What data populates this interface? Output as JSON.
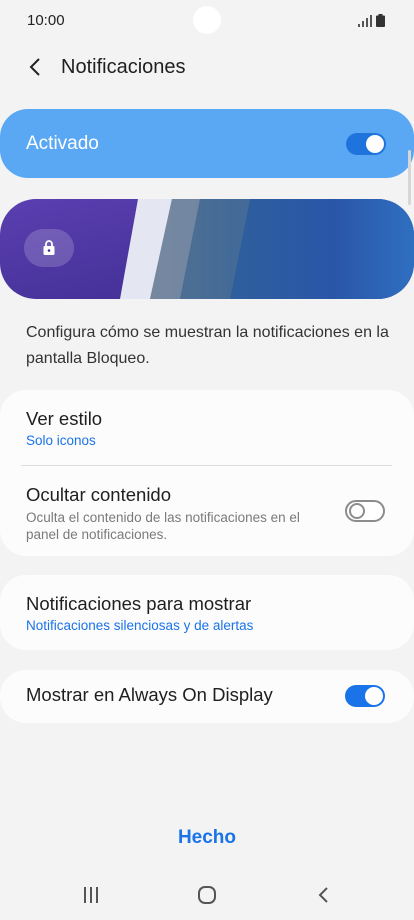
{
  "status_bar": {
    "time": "10:00"
  },
  "header": {
    "title": "Notificaciones"
  },
  "master_toggle": {
    "label": "Activado",
    "on": true
  },
  "description": "Configura cómo se muestran la notificaciones en la pantalla Bloqueo.",
  "settings": {
    "view_style": {
      "title": "Ver estilo",
      "value": "Solo iconos"
    },
    "hide_content": {
      "title": "Ocultar contenido",
      "subtitle": "Oculta el contenido de las notificaciones en el panel de notificaciones.",
      "on": false
    },
    "notifications_to_show": {
      "title": "Notificaciones para mostrar",
      "value": "Notificaciones silenciosas y de alertas"
    },
    "always_on_display": {
      "title": "Mostrar en Always On Display",
      "on": true
    }
  },
  "done_button": {
    "label": "Hecho"
  },
  "colors": {
    "accent": "#1a73e8",
    "master_bg": "#5aa8f4",
    "background": "#f3f3f3"
  },
  "icons": [
    "back-arrow-icon",
    "signal-icon",
    "battery-icon",
    "lock-icon",
    "recent-apps-icon",
    "home-icon",
    "nav-back-icon"
  ]
}
